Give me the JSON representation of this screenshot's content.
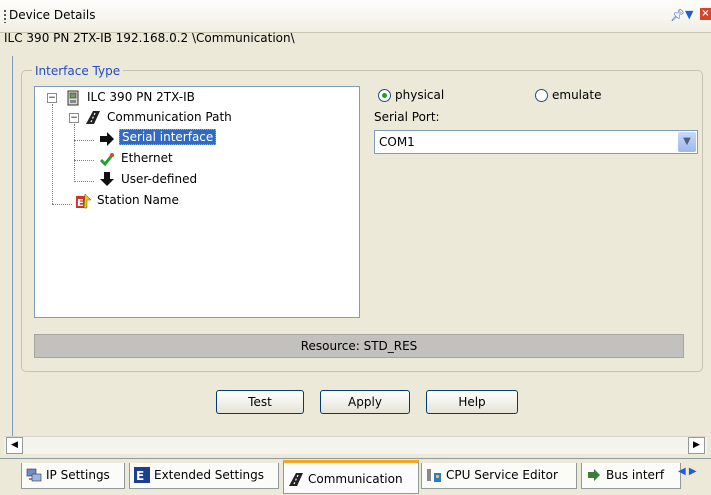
{
  "window": {
    "title": "Device Details",
    "subtitle": "ILC 390 PN 2TX-IB 192.168.0.2 \\Communication\\"
  },
  "interface_type": {
    "label": "Interface Type",
    "tree": [
      {
        "label": "ILC 390 PN 2TX-IB",
        "expander": "−",
        "icon": "device-icon"
      },
      {
        "label": "Communication Path",
        "expander": "−",
        "icon": "communication-path-icon"
      },
      {
        "label": "Serial interface",
        "icon": "arrow-right-icon",
        "selected": true
      },
      {
        "label": "Ethernet",
        "icon": "checkmark-icon"
      },
      {
        "label": "User-defined",
        "icon": "arrow-down-icon"
      },
      {
        "label": "Station Name",
        "icon": "station-name-icon"
      }
    ]
  },
  "mode": {
    "physical_label": "physical",
    "emulate_label": "emulate",
    "selected": "physical"
  },
  "serial_port": {
    "label": "Serial Port:",
    "value": "COM1"
  },
  "resource": {
    "text": "Resource: STD_RES"
  },
  "buttons": {
    "test": "Test",
    "apply": "Apply",
    "help": "Help"
  },
  "tabs": [
    {
      "label": "IP Settings",
      "icon": "network-icon"
    },
    {
      "label": "Extended Settings",
      "icon": "extended-settings-icon"
    },
    {
      "label": "Communication",
      "icon": "communication-icon",
      "active": true
    },
    {
      "label": "CPU Service Editor",
      "icon": "cpu-icon"
    },
    {
      "label": "Bus interf",
      "icon": "bus-interface-icon"
    }
  ],
  "colors": {
    "accent": "#316ac5",
    "active_tab": "#f5a623",
    "radio_dot": "#21a121"
  }
}
